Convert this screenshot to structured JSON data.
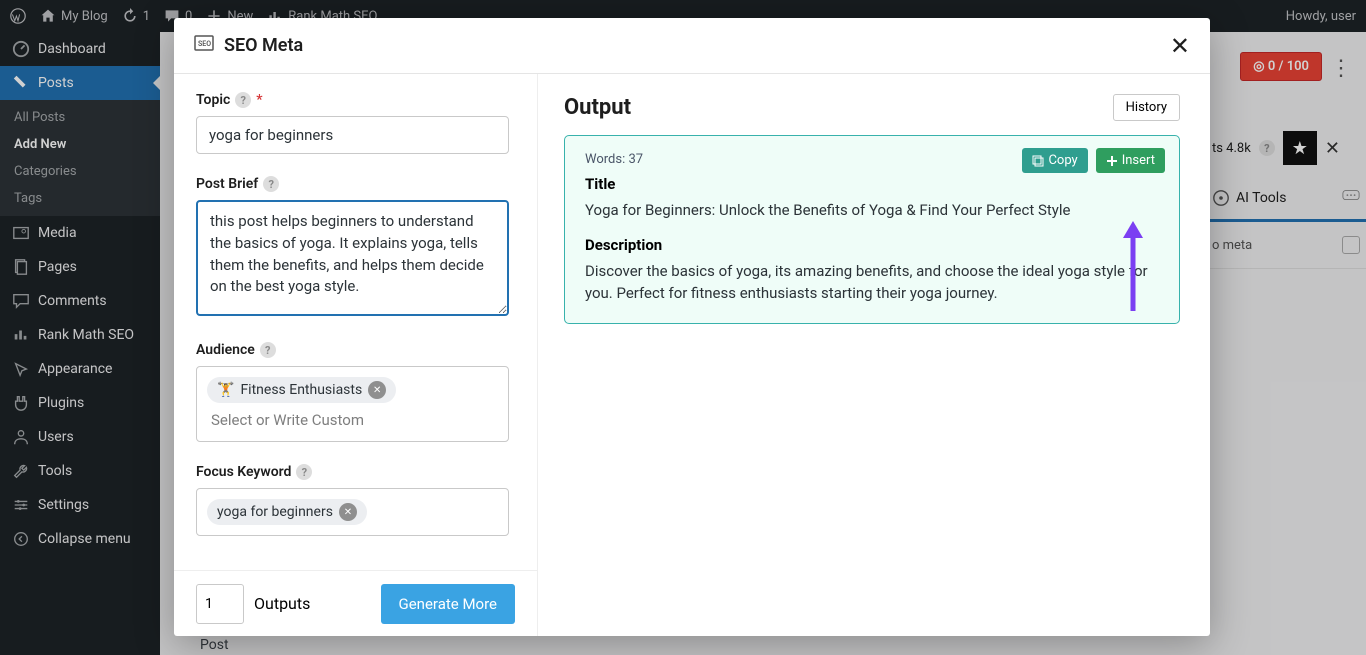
{
  "adminbar": {
    "site": "My Blog",
    "updates": "1",
    "comments": "0",
    "new": "New",
    "rankmath": "Rank Math SEO",
    "howdy": "Howdy, user"
  },
  "sidebar": {
    "items": [
      {
        "label": "Dashboard"
      },
      {
        "label": "Posts"
      },
      {
        "label": "Media"
      },
      {
        "label": "Pages"
      },
      {
        "label": "Comments"
      },
      {
        "label": "Rank Math SEO"
      },
      {
        "label": "Appearance"
      },
      {
        "label": "Plugins"
      },
      {
        "label": "Users"
      },
      {
        "label": "Tools"
      },
      {
        "label": "Settings"
      },
      {
        "label": "Collapse menu"
      }
    ],
    "posts_sub": [
      {
        "label": "All Posts"
      },
      {
        "label": "Add New"
      },
      {
        "label": "Categories"
      },
      {
        "label": "Tags"
      }
    ]
  },
  "rightbar": {
    "score": "0 / 100",
    "credits": "ts 4.8k",
    "ai_tools": "AI Tools",
    "meta_placeholder": "o meta"
  },
  "modal": {
    "title": "SEO Meta",
    "topic_label": "Topic",
    "topic_value": "yoga for beginners",
    "brief_label": "Post Brief",
    "brief_value": "this post helps beginners to understand the basics of yoga. It explains yoga, tells them the benefits, and helps them decide on the best yoga style.",
    "audience_label": "Audience",
    "audience_tag": "Fitness Enthusiasts",
    "audience_placeholder": "Select or Write Custom",
    "keyword_label": "Focus Keyword",
    "keyword_tag": "yoga for beginners",
    "outputs_label": "Outputs",
    "outputs_value": "1",
    "generate": "Generate More",
    "output_heading": "Output",
    "history": "History",
    "word_count": "Words: 37",
    "copy": "Copy",
    "insert": "Insert",
    "t_label": "Title",
    "t_text": "Yoga for Beginners: Unlock the Benefits of Yoga & Find Your Perfect Style",
    "d_label": "Description",
    "d_text": "Discover the basics of yoga, its amazing benefits, and choose the ideal yoga style for you. Perfect for fitness enthusiasts starting their yoga journey."
  },
  "post_label": "Post"
}
